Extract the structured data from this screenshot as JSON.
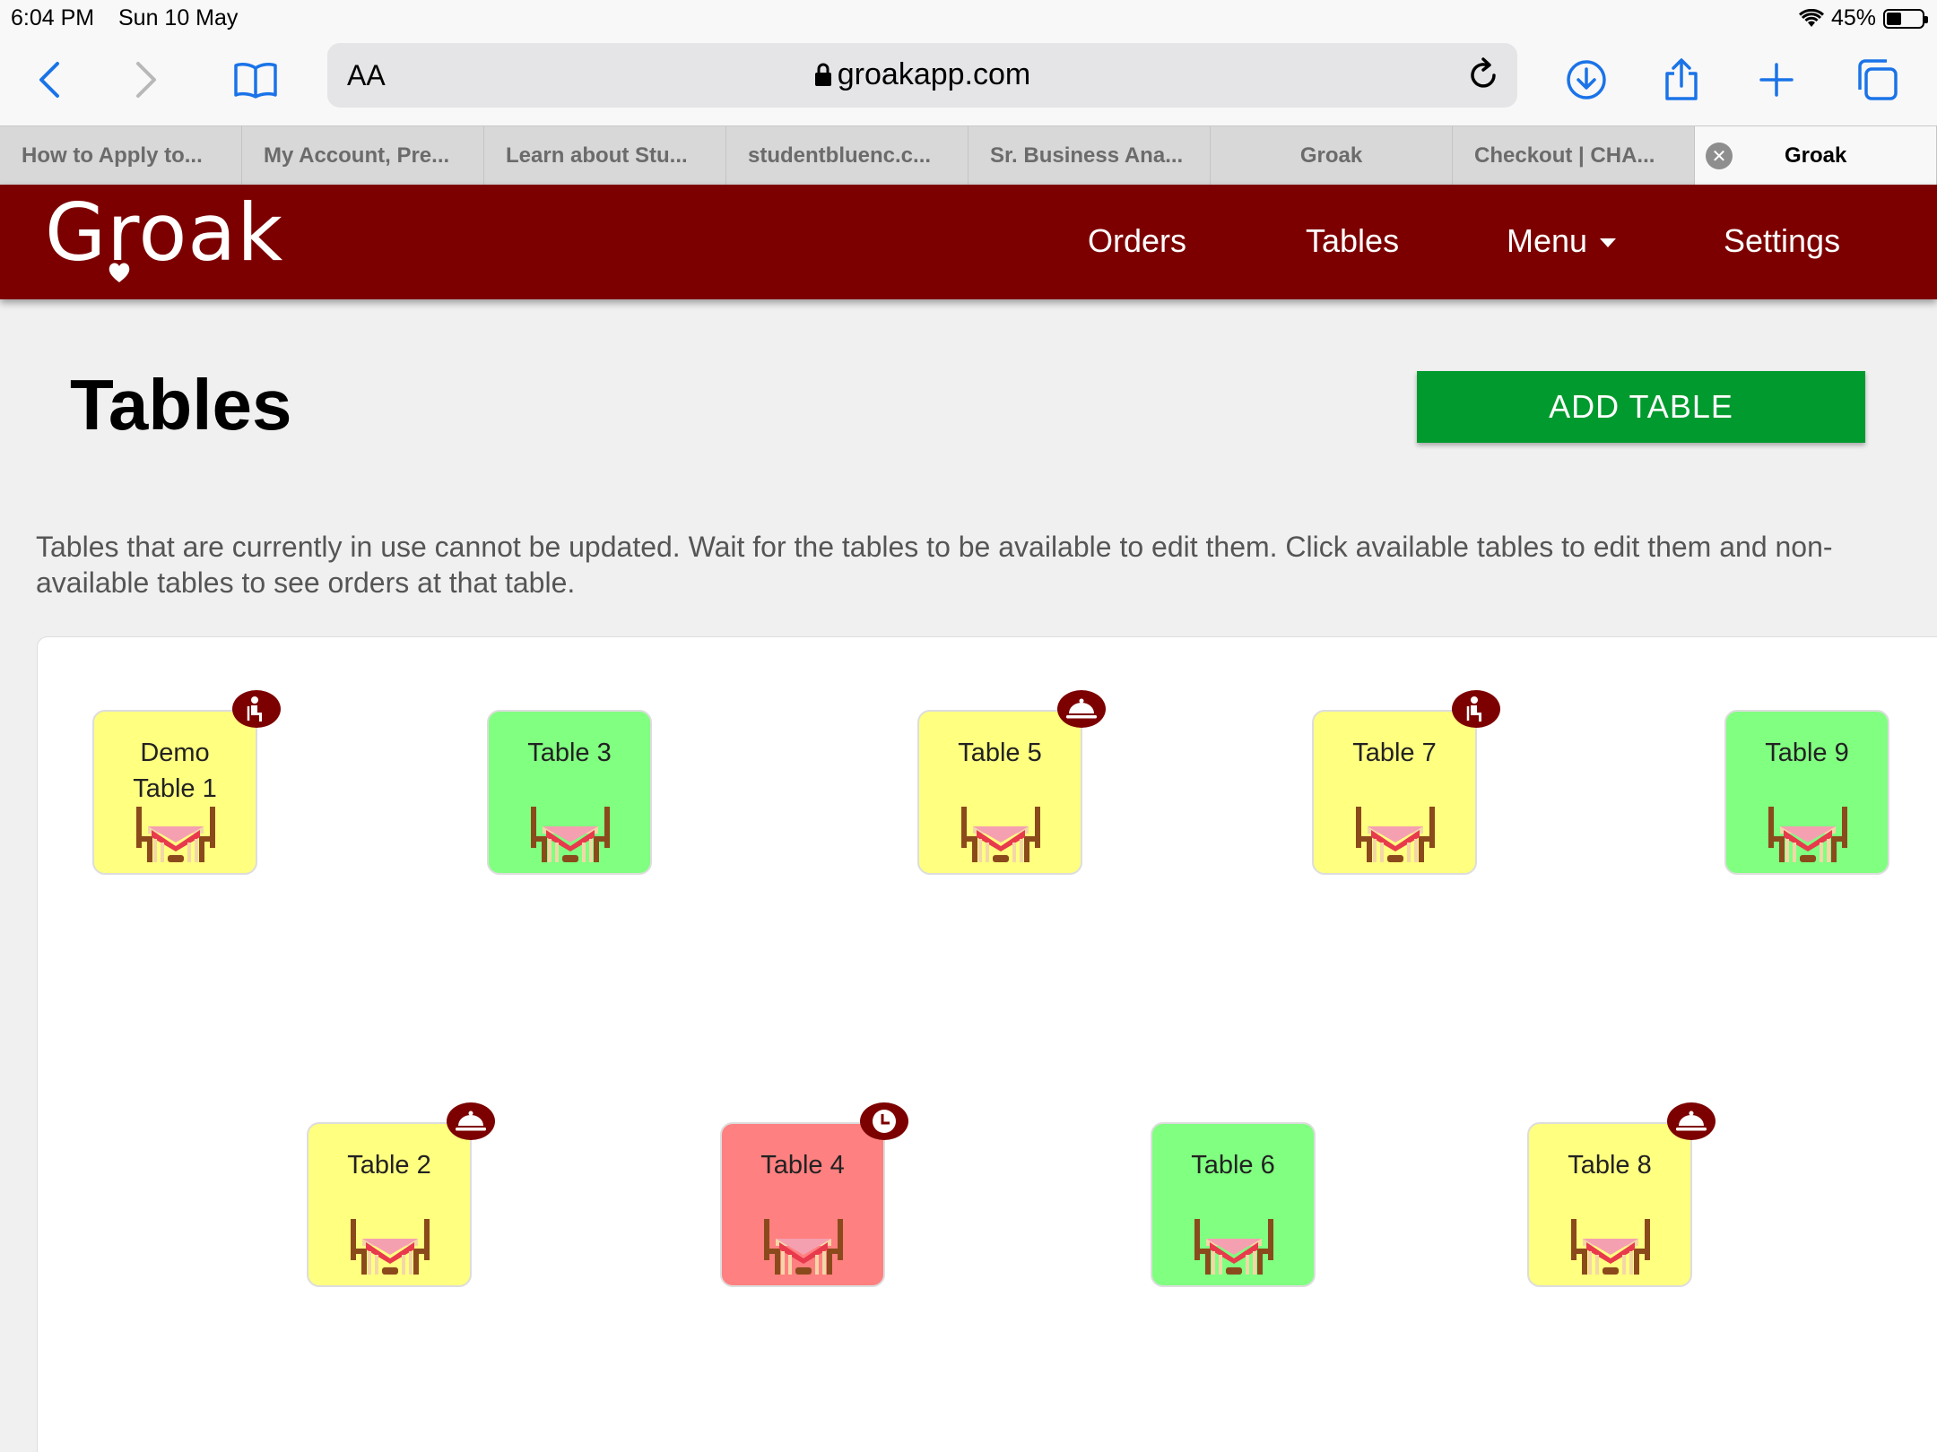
{
  "status": {
    "time": "6:04 PM",
    "date": "Sun 10 May",
    "battery": "45%"
  },
  "toolbar": {
    "aa": "AA",
    "url": "groakapp.com"
  },
  "tabs": [
    {
      "label": "How to Apply to..."
    },
    {
      "label": "My Account, Pre..."
    },
    {
      "label": "Learn about Stu..."
    },
    {
      "label": "studentbluenc.c..."
    },
    {
      "label": "Sr. Business Ana..."
    },
    {
      "label": "Groak"
    },
    {
      "label": "Checkout | CHA..."
    },
    {
      "label": "Groak"
    }
  ],
  "app": {
    "logo": "Groak",
    "nav": {
      "orders": "Orders",
      "tables": "Tables",
      "menu": "Menu",
      "settings": "Settings"
    }
  },
  "page": {
    "title": "Tables",
    "add_button": "ADD TABLE",
    "info": "Tables that are currently in use cannot be updated. Wait for the tables to be available to edit them. Click available tables to edit them and non-available tables to see orders at that table."
  },
  "tables": [
    {
      "name": "Demo Table 1",
      "status": "yellow",
      "badge": "person-icon"
    },
    {
      "name": "Table 3",
      "status": "green",
      "badge": ""
    },
    {
      "name": "Table 5",
      "status": "yellow",
      "badge": "cloche-icon"
    },
    {
      "name": "Table 7",
      "status": "yellow",
      "badge": "person-icon"
    },
    {
      "name": "Table 9",
      "status": "green",
      "badge": ""
    },
    {
      "name": "Table 2",
      "status": "yellow",
      "badge": "cloche-icon"
    },
    {
      "name": "Table 4",
      "status": "red",
      "badge": "clock-icon"
    },
    {
      "name": "Table 6",
      "status": "green",
      "badge": ""
    },
    {
      "name": "Table 8",
      "status": "yellow",
      "badge": "cloche-icon"
    }
  ],
  "colors": {
    "brand": "#7d0000",
    "add_button": "#009a2e",
    "available": "#80ff80",
    "in_use": "#ffff80",
    "waiting": "#ff8080"
  }
}
